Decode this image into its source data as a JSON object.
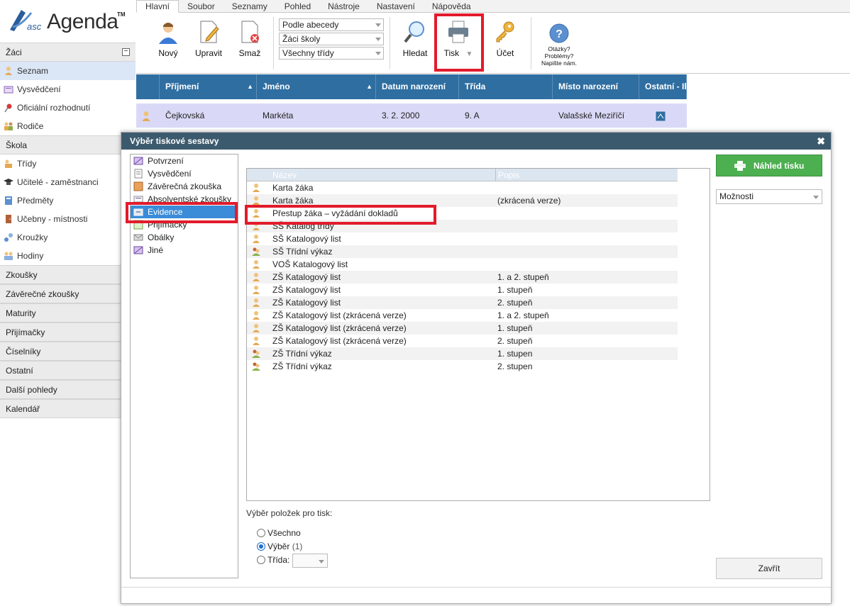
{
  "logo": {
    "asc": "asc",
    "agenda": "Agenda",
    "tm": "TM"
  },
  "menubar": [
    "Hlavní",
    "Soubor",
    "Seznamy",
    "Pohled",
    "Nástroje",
    "Nastavení",
    "Nápověda"
  ],
  "ribbon": {
    "new": "Nový",
    "edit": "Upravit",
    "delete": "Smaž",
    "sort_combo": "Podle abecedy",
    "scope_combo": "Žáci školy",
    "class_combo": "Všechny třídy",
    "search": "Hledat",
    "print": "Tisk",
    "account": "Účet",
    "help_line1": "Otázky?",
    "help_line2": "Problémy?",
    "help_line3": "Napište nám."
  },
  "sidebar": {
    "zaci": "Žáci",
    "zaci_items": [
      "Seznam",
      "Vysvědčení",
      "Oficiální rozhodnutí",
      "Rodiče"
    ],
    "skola": "Škola",
    "skola_items": [
      "Třídy",
      "Učitelé - zaměstnanci",
      "Předměty",
      "Učebny - místnosti",
      "Kroužky",
      "Hodiny"
    ],
    "sections": [
      "Zkoušky",
      "Závěrečné zkoušky",
      "Maturity",
      "Přijímačky",
      "Číselníky",
      "Ostatní",
      "Další pohledy",
      "Kalendář"
    ]
  },
  "grid": {
    "headers": [
      "Příjmení",
      "Jméno",
      "Datum narození",
      "Třída",
      "Místo narození",
      "Ostatní - Il"
    ],
    "row": {
      "surname": "Čejkovská",
      "name": "Markéta",
      "dob": "3. 2. 2000",
      "class": "9. A",
      "birthplace": "Valašské Meziříčí"
    }
  },
  "dialog": {
    "title": "Výběr tiskové sestavy",
    "close_glyph": "✖",
    "categories": [
      "Potvrzení",
      "Vysvědčení",
      "Závěrečná zkouška",
      "Absolventské zkoušky",
      "Evidence",
      "Přijímačky",
      "Obálky",
      "Jiné"
    ],
    "list_header": {
      "name": "Název",
      "desc": "Popis"
    },
    "reports": [
      {
        "name": "Karta žáka",
        "desc": ""
      },
      {
        "name": "Karta žáka",
        "desc": "(zkrácená verze)"
      },
      {
        "name": "Přestup žáka – vyžádání dokladů",
        "desc": ""
      },
      {
        "name": "SŠ Katalog třídy",
        "desc": ""
      },
      {
        "name": "SŠ Katalogový list",
        "desc": ""
      },
      {
        "name": "SŠ Třídní výkaz",
        "desc": ""
      },
      {
        "name": "VOŠ Katalogový list",
        "desc": ""
      },
      {
        "name": "ZŠ Katalogový list",
        "desc": "1. a 2. stupeň"
      },
      {
        "name": "ZŠ Katalogový list",
        "desc": "1. stupeň"
      },
      {
        "name": "ZŠ Katalogový list",
        "desc": "2. stupeň"
      },
      {
        "name": "ZŠ Katalogový list (zkrácená verze)",
        "desc": "1. a 2. stupeň"
      },
      {
        "name": "ZŠ Katalogový list (zkrácená verze)",
        "desc": "1. stupeň"
      },
      {
        "name": "ZŠ Katalogový list (zkrácená verze)",
        "desc": "2. stupeň"
      },
      {
        "name": "ZŠ Třídní výkaz",
        "desc": "1. stupen"
      },
      {
        "name": "ZŠ Třídní výkaz",
        "desc": "2. stupen"
      }
    ],
    "selection_label": "Výběr položek pro tisk:",
    "radio_all": "Všechno",
    "radio_selection": "Výběr",
    "radio_selection_count": "(1)",
    "radio_class": "Třída:",
    "preview_button": "Náhled tisku",
    "options_combo": "Možnosti",
    "close_button": "Zavřít"
  },
  "colors": {
    "highlight": "#e21b2b",
    "grid_header": "#2f6ea1",
    "preview_green": "#4caf50",
    "dialog_title": "#3c5a6e",
    "selected": "#3a8cd8"
  }
}
